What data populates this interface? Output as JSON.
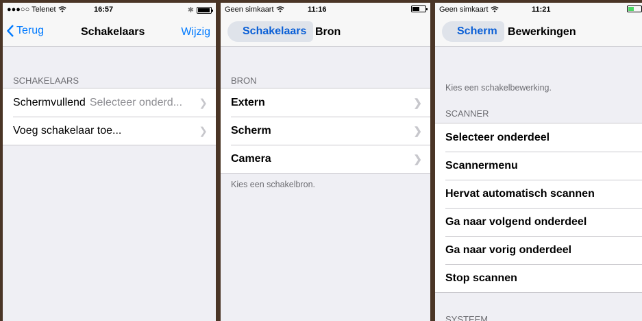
{
  "screen1": {
    "status": {
      "carrier": "●●●○○ Telenet",
      "time": "16:57",
      "bluetooth": "✱"
    },
    "nav": {
      "back": "Terug",
      "title": "Schakelaars",
      "edit": "Wijzig"
    },
    "section_header": "SCHAKELAARS",
    "rows": [
      {
        "label": "Schermvullend",
        "value": "Selecteer onderd..."
      },
      {
        "label": "Voeg schakelaar toe...",
        "value": ""
      }
    ]
  },
  "screen2": {
    "status": {
      "carrier": "Geen simkaart",
      "time": "11:16"
    },
    "nav": {
      "back": "Schakelaars",
      "title": "Bron"
    },
    "section_header": "BRON",
    "rows": [
      {
        "label": "Extern"
      },
      {
        "label": "Scherm"
      },
      {
        "label": "Camera"
      }
    ],
    "footer": "Kies een schakelbron."
  },
  "screen3": {
    "status": {
      "carrier": "Geen simkaart",
      "time": "11:21"
    },
    "nav": {
      "back": "Scherm",
      "title": "Bewerkingen"
    },
    "intro": "Kies een schakelbewerking.",
    "section_header": "SCANNER",
    "rows": [
      {
        "label": "Selecteer onderdeel"
      },
      {
        "label": "Scannermenu"
      },
      {
        "label": "Hervat automatisch scannen"
      },
      {
        "label": "Ga naar volgend onderdeel"
      },
      {
        "label": "Ga naar vorig onderdeel"
      },
      {
        "label": "Stop scannen"
      }
    ],
    "section_header_2": "SYSTEEM"
  },
  "icons": {
    "wifi": "wifi-icon",
    "battery": "battery-icon",
    "back_chevron": "chevron-left-icon",
    "row_chevron": "chevron-right-icon"
  },
  "colors": {
    "accent": "#007aff",
    "background": "#efeff4",
    "separator": "#c8c7cc",
    "secondary_text": "#6d6d72",
    "battery_charging": "#4cd964"
  }
}
